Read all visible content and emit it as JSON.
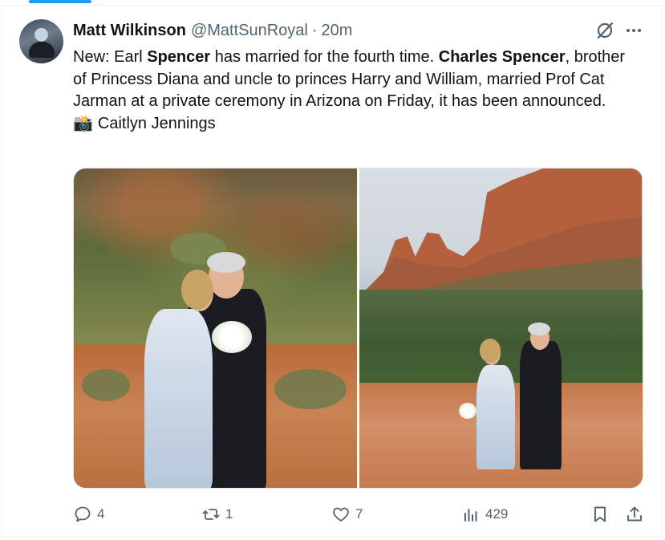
{
  "tweet": {
    "author_name": "Matt Wilkinson",
    "author_handle": "@MattSunRoyal",
    "separator": "·",
    "time": "20m",
    "text": {
      "part1": "New: Earl ",
      "bold1": "Spencer",
      "part2": " has married for the fourth time. ",
      "bold2": "Charles Spencer",
      "part3": ", brother of Princess Diana and uncle to princes Harry and William, married Prof Cat Jarman at a private ceremony in Arizona on Friday, it has been announced.",
      "credit_emoji": "📸",
      "credit_name": "Caitlyn Jennings"
    }
  },
  "actions": {
    "replies": "4",
    "retweets": "1",
    "likes": "7",
    "views": "429"
  },
  "icons": {
    "avatar": "avatar-photo",
    "grok": "grok-icon",
    "more": "more-icon",
    "reply": "reply-icon",
    "retweet": "retweet-icon",
    "like": "heart-icon",
    "views": "views-icon",
    "bookmark": "bookmark-icon",
    "share": "share-icon"
  },
  "colors": {
    "accent": "#1d9bf0",
    "text_primary": "#0f1419",
    "text_secondary": "#536471"
  }
}
